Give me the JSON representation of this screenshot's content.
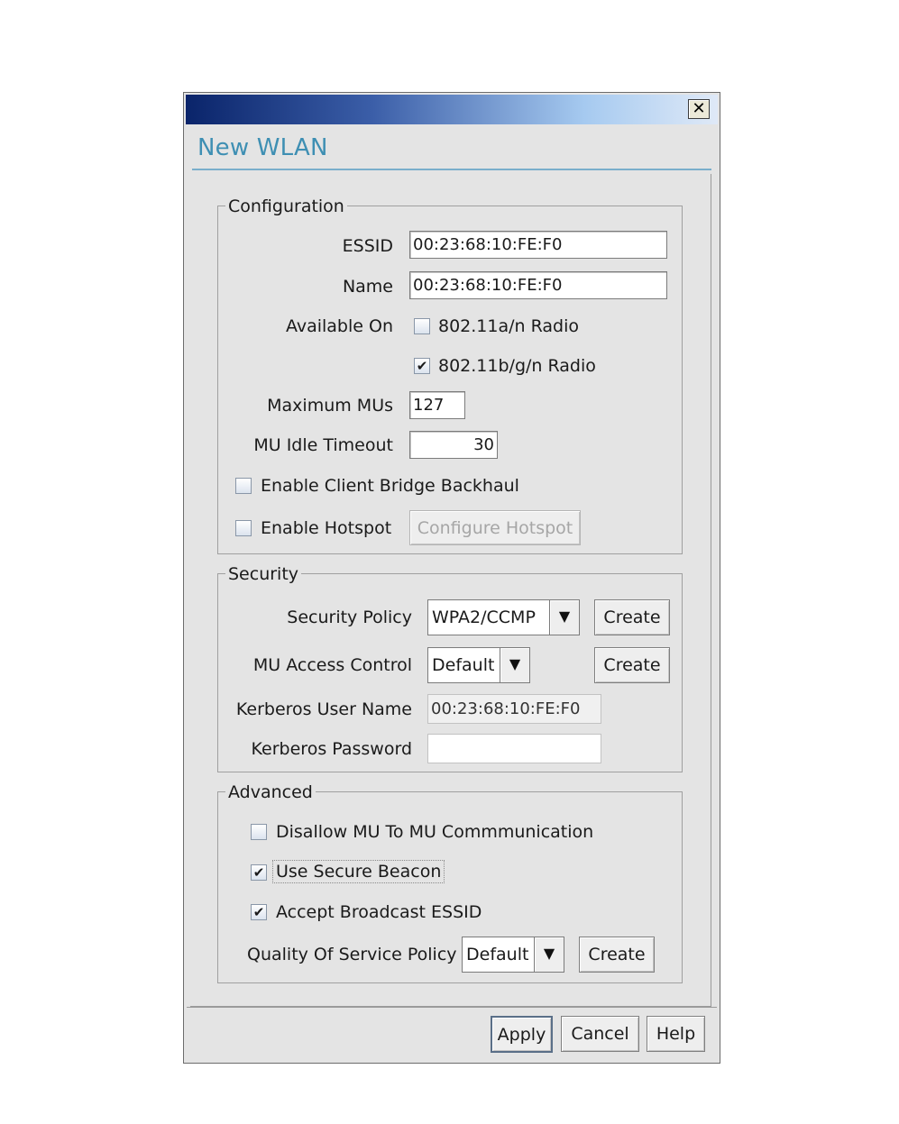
{
  "window": {
    "title": "New WLAN",
    "close_glyph": "✕",
    "close_icon": "close-icon"
  },
  "configuration": {
    "legend": "Configuration",
    "essid_label": "ESSID",
    "essid_value": "00:23:68:10:FE:F0",
    "name_label": "Name",
    "name_value": "00:23:68:10:FE:F0",
    "available_on_label": "Available On",
    "radio_a_label": "802.11a/n Radio",
    "radio_a_checked": false,
    "radio_bg_label": "802.11b/g/n Radio",
    "radio_bg_checked": true,
    "max_mus_label": "Maximum MUs",
    "max_mus_value": "127",
    "idle_timeout_label": "MU Idle Timeout",
    "idle_timeout_value": "30",
    "client_bridge_label": "Enable Client Bridge Backhaul",
    "client_bridge_checked": false,
    "hotspot_label": "Enable Hotspot",
    "hotspot_checked": false,
    "configure_hotspot_label": "Configure Hotspot"
  },
  "security": {
    "legend": "Security",
    "policy_label": "Security Policy",
    "policy_value": "WPA2/CCMP",
    "policy_create": "Create",
    "access_label": "MU Access Control",
    "access_value": "Default",
    "access_create": "Create",
    "kerberos_user_label": "Kerberos User Name",
    "kerberos_user_value": "00:23:68:10:FE:F0",
    "kerberos_pass_label": "Kerberos Password",
    "kerberos_pass_value": ""
  },
  "advanced": {
    "legend": "Advanced",
    "disallow_label": "Disallow MU To MU Commmunication",
    "disallow_checked": false,
    "secure_beacon_label": "Use Secure Beacon",
    "secure_beacon_checked": true,
    "broadcast_essid_label": "Accept Broadcast ESSID",
    "broadcast_essid_checked": true,
    "qos_label": "Quality Of Service Policy",
    "qos_value": "Default",
    "qos_create": "Create"
  },
  "footer": {
    "apply": "Apply",
    "cancel": "Cancel",
    "help": "Help"
  },
  "glyphs": {
    "check": "✔",
    "dropdown": "▼"
  },
  "colors": {
    "title_text": "#3e8fb3",
    "titlebar_start": "#0a246a",
    "titlebar_end": "#dfe9f7",
    "window_bg": "#e4e4e4"
  }
}
